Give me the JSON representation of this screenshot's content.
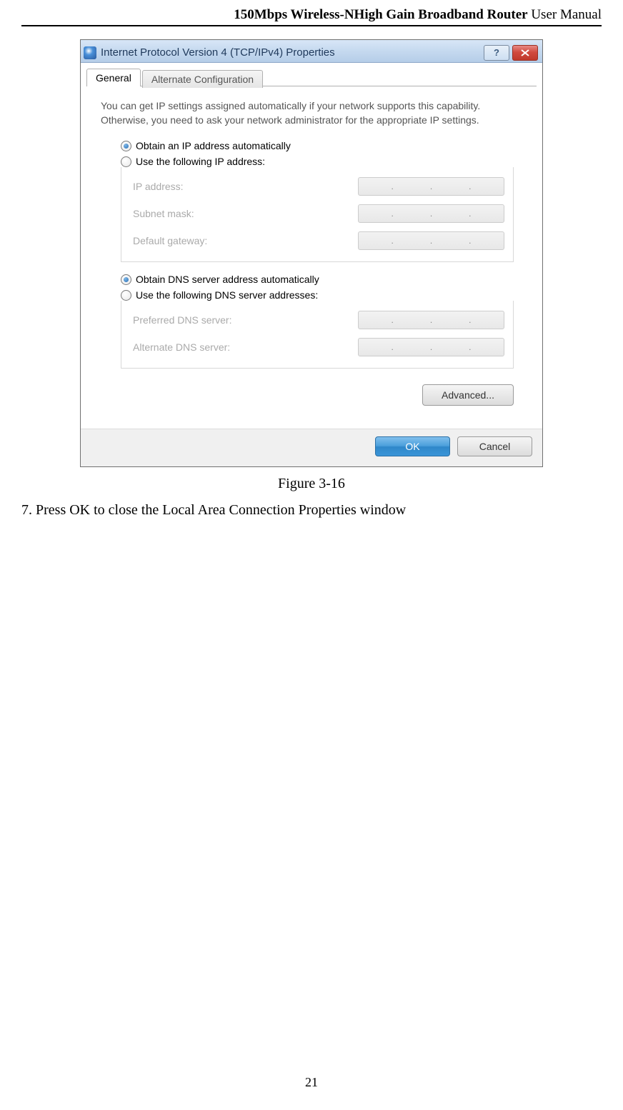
{
  "header": {
    "bold": "150Mbps Wireless-NHigh Gain Broadband Router",
    "normal": " User Manual"
  },
  "dialog": {
    "title": "Internet Protocol Version 4 (TCP/IPv4) Properties",
    "tabs": {
      "general": "General",
      "alt": "Alternate Configuration"
    },
    "intro": "You can get IP settings assigned automatically if your network supports this capability. Otherwise, you need to ask your network administrator for the appropriate IP settings.",
    "ip_auto": "Obtain an IP address automatically",
    "ip_manual": "Use the following IP address:",
    "ip_fields": {
      "ip": "IP address:",
      "subnet": "Subnet mask:",
      "gateway": "Default gateway:"
    },
    "dns_auto": "Obtain DNS server address automatically",
    "dns_manual": "Use the following DNS server addresses:",
    "dns_fields": {
      "preferred": "Preferred DNS server:",
      "alternate": "Alternate DNS server:"
    },
    "advanced": "Advanced...",
    "ok": "OK",
    "cancel": "Cancel"
  },
  "caption": "Figure 3-16",
  "step": "7. Press OK to close the Local Area Connection Properties window",
  "page_number": "21"
}
